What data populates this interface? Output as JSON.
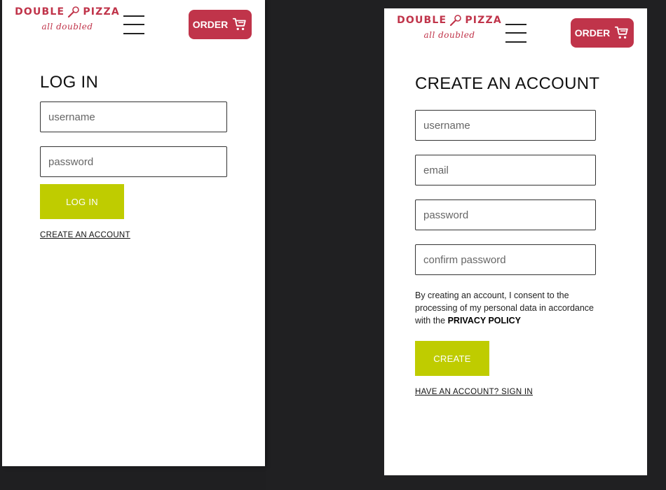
{
  "brand": {
    "name_left": "DOUBLE",
    "name_right": "PIZZA",
    "tagline": "all doubled",
    "brand_color": "#c0344a",
    "accent_color": "#bfcc00"
  },
  "header": {
    "order_label": "ORDER",
    "menu_icon": "hamburger-menu-icon",
    "cart_icon": "shopping-cart-icon"
  },
  "login": {
    "title": "LOG IN",
    "username_placeholder": "username",
    "password_placeholder": "password",
    "submit_label": "LOG IN",
    "create_account_link": "CREATE AN ACCOUNT"
  },
  "register": {
    "title": "CREATE AN ACCOUNT",
    "username_placeholder": "username",
    "email_placeholder": "email",
    "password_placeholder": "password",
    "confirm_placeholder": "confirm password",
    "consent_text": "By creating an account, I consent to the processing of my personal data in accordance with the",
    "privacy_link": "PRIVACY POLICY",
    "submit_label": "CREATE",
    "signin_link": "HAVE AN ACCOUNT? SIGN IN"
  }
}
